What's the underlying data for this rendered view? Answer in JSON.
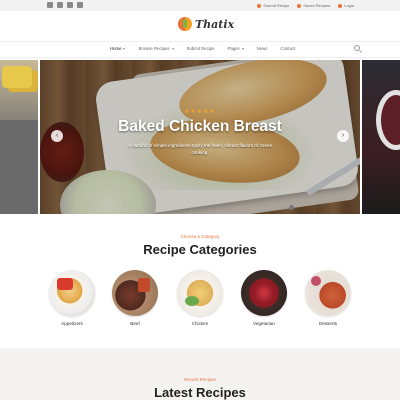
{
  "topbar": {
    "social_icons": [
      "facebook-icon",
      "twitter-icon",
      "instagram-icon",
      "youtube-icon"
    ],
    "links": [
      {
        "label": "Submit Recipe",
        "icon": "edit-icon"
      },
      {
        "label": "Saved Recipes",
        "icon": "heart-icon"
      },
      {
        "label": "Login",
        "icon": "user-icon"
      }
    ]
  },
  "logo": {
    "text": "Thatix"
  },
  "nav": {
    "items": [
      {
        "label": "Home",
        "has_dropdown": true,
        "active": true
      },
      {
        "label": "Browse Recipes",
        "has_dropdown": true
      },
      {
        "label": "Submit Recipe",
        "has_dropdown": false
      },
      {
        "label": "Pages",
        "has_dropdown": true
      },
      {
        "label": "News",
        "has_dropdown": false
      },
      {
        "label": "Contact",
        "has_dropdown": false
      }
    ]
  },
  "hero": {
    "rating_stars": "★★★★★",
    "title": "Baked Chicken Breast",
    "description": "A handful of simple ingredients typify the fresh, vibrant flavors of Greek cooking.",
    "prev_arrow": "‹",
    "next_arrow": "›"
  },
  "categories": {
    "subtitle": "Choose a Category",
    "title": "Recipe Categories",
    "items": [
      {
        "label": "Appetizers"
      },
      {
        "label": "Beef"
      },
      {
        "label": "Chicken"
      },
      {
        "label": "Vegetarian"
      },
      {
        "label": "Desserts"
      }
    ]
  },
  "latest": {
    "subtitle": "Recent Recipes",
    "title": "Latest Recipes"
  },
  "colors": {
    "accent": "#e8753d",
    "star": "#f0a42c"
  }
}
